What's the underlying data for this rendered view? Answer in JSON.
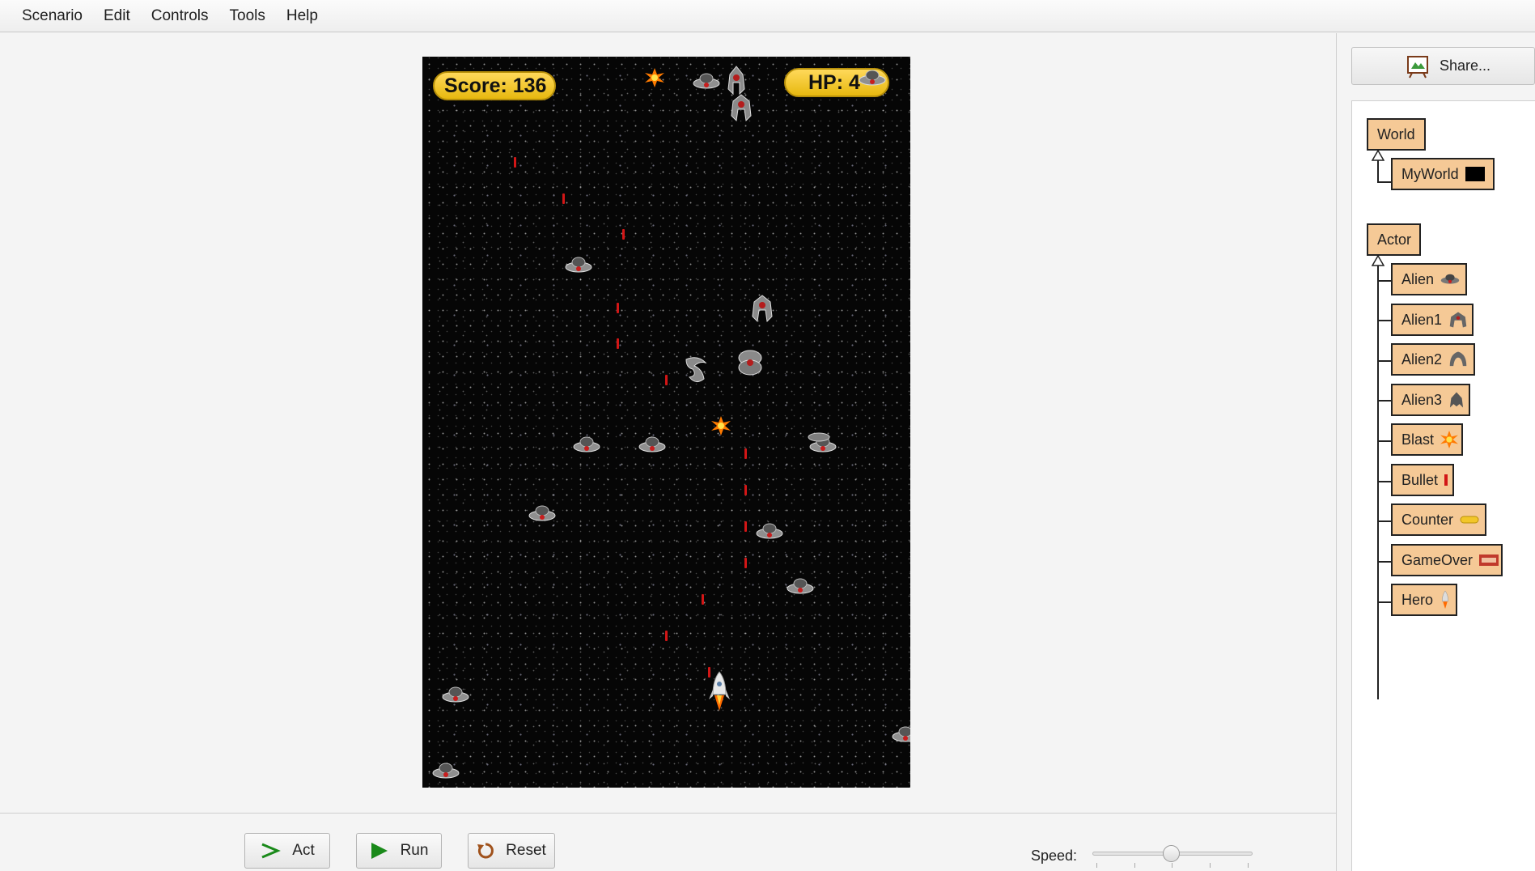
{
  "menu": [
    "Scenario",
    "Edit",
    "Controls",
    "Tools",
    "Help"
  ],
  "hud": {
    "score": "Score: 136",
    "hp": "HP: 4"
  },
  "controls": {
    "act": "Act",
    "run": "Run",
    "reset": "Reset",
    "speed_label": "Speed:"
  },
  "share": {
    "label": "Share..."
  },
  "world_classes": {
    "root": "World",
    "children": [
      "MyWorld"
    ]
  },
  "actor_classes": {
    "root": "Actor",
    "children": [
      "Alien",
      "Alien1",
      "Alien2",
      "Alien3",
      "Blast",
      "Bullet",
      "Counter",
      "GameOver",
      "Hero"
    ]
  },
  "colors": {
    "class_box": "#f5c996",
    "hud_yellow": "#f2c62a",
    "bullet_red": "#d21616",
    "run_green": "#1a8a1a"
  }
}
